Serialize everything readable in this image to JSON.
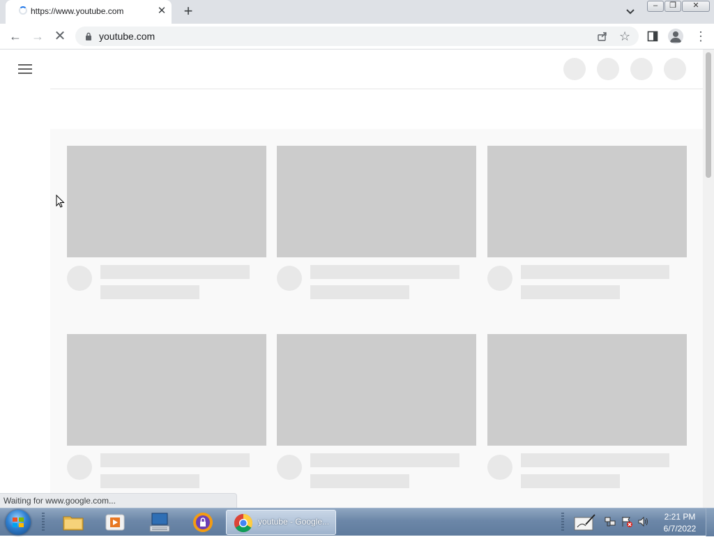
{
  "browser": {
    "tab_title": "https://www.youtube.com",
    "tab_close": "✕",
    "new_tab": "+",
    "url": "youtube.com",
    "status_text": "Waiting for www.google.com..."
  },
  "window_controls": {
    "minimize": "–",
    "restore": "❐",
    "close": "✕"
  },
  "toolbar": {
    "back": "←",
    "forward": "→",
    "stop": "✕",
    "star": "☆",
    "menu": "⋮"
  },
  "page": {
    "masthead_placeholders": 4,
    "video_skeleton_rows": 2,
    "video_skeleton_columns": 3,
    "colors": {
      "thumbnail": "#cccccc",
      "text_placeholder": "#e6e6e6",
      "background": "#f9f9f9"
    }
  },
  "taskbar": {
    "pinned": [
      "file-explorer-icon",
      "media-player-icon",
      "keyboard-monitor-icon",
      "vpn-lock-icon"
    ],
    "active_task_label": "youtube - Google...",
    "clock": {
      "time": "2:21 PM",
      "date": "6/7/2022"
    }
  }
}
